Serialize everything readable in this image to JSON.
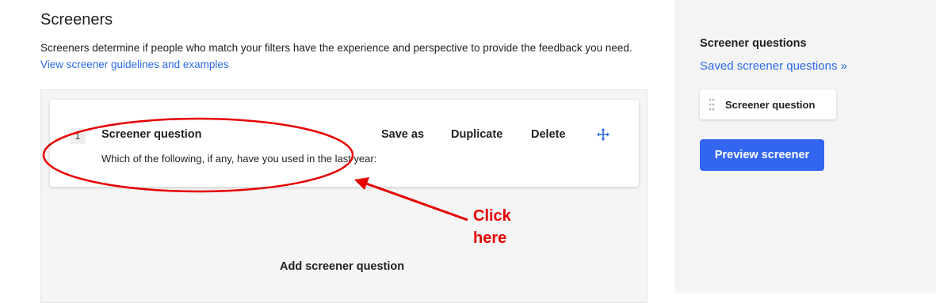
{
  "main": {
    "title": "Screeners",
    "description": "Screeners determine if people who match your filters have the experience and perspective to provide the feedback you need.",
    "guidelines_link": "View screener guidelines and examples",
    "question": {
      "number": "1",
      "title": "Screener question",
      "text": "Which of the following, if any, have you used in the last year:",
      "actions": [
        "Save as",
        "Duplicate",
        "Delete"
      ],
      "move_icon": "move-arrows-icon"
    },
    "add_question_label": "Add screener question"
  },
  "annotation": {
    "line1": "Click",
    "line2": "here",
    "color": "#e60000"
  },
  "sidebar": {
    "heading": "Screener questions",
    "saved_link": "Saved screener questions »",
    "chip_label": "Screener question",
    "chip_icon": "drag-handle-icon",
    "preview_button": "Preview screener"
  },
  "colors": {
    "accent": "#3366f0",
    "link": "#2a6ae9",
    "sidebar_bg": "#f4f4f4"
  }
}
